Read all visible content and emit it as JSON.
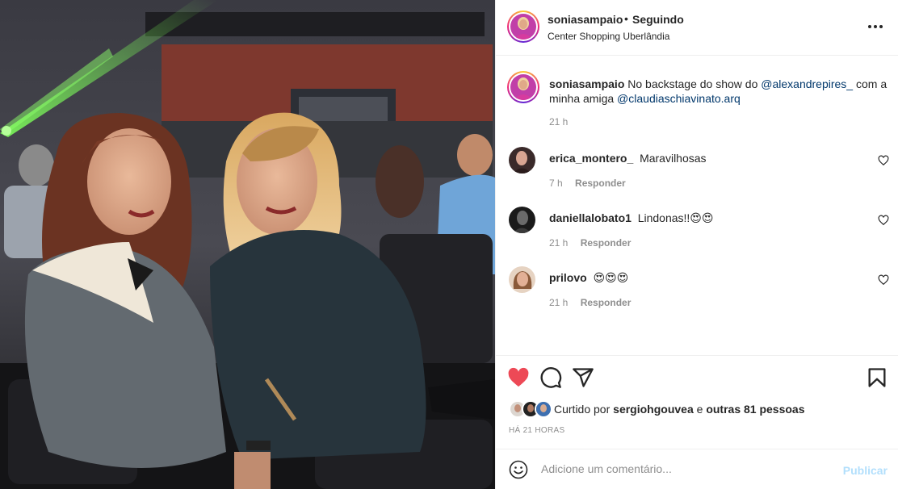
{
  "post": {
    "author": "soniasampaio",
    "separator": "•",
    "follow_status": "Seguindo",
    "location": "Center Shopping Uberlândia",
    "more_icon": "more-horizontal-icon",
    "caption": {
      "username": "soniasampaio",
      "text_1": " No backstage do show do ",
      "mention_1": "@alexandrepires_",
      "text_2": " com a minha amiga ",
      "mention_2": "@claudiaschiavinato.arq",
      "time": "21 h"
    }
  },
  "comments": [
    {
      "username": "erica_montero_",
      "text": "Maravilhosas",
      "time": "7 h",
      "reply": "Responder"
    },
    {
      "username": "daniellalobato1",
      "text": "Lindonas!!😍😍",
      "time": "21 h",
      "reply": "Responder"
    },
    {
      "username": "prilovo",
      "text": "😍😍😍",
      "time": "21 h",
      "reply": "Responder"
    }
  ],
  "actions": {
    "like_icon": "heart-filled-icon",
    "comment_icon": "comment-icon",
    "share_icon": "share-icon",
    "save_icon": "bookmark-icon",
    "liked_prefix": "Curtido por ",
    "liked_user": "sergiohgouvea",
    "liked_mid": " e ",
    "liked_others": "outras 81 pessoas",
    "posted_ago": "HÁ 21 HORAS"
  },
  "add_comment": {
    "emoji_icon": "emoji-icon",
    "placeholder": "Adicione um comentário...",
    "publish_label": "Publicar"
  },
  "colors": {
    "like_red": "#ed4956",
    "mention_blue": "#00376b",
    "publish_disabled": "#b2dffc",
    "muted": "#8e8e8e"
  }
}
